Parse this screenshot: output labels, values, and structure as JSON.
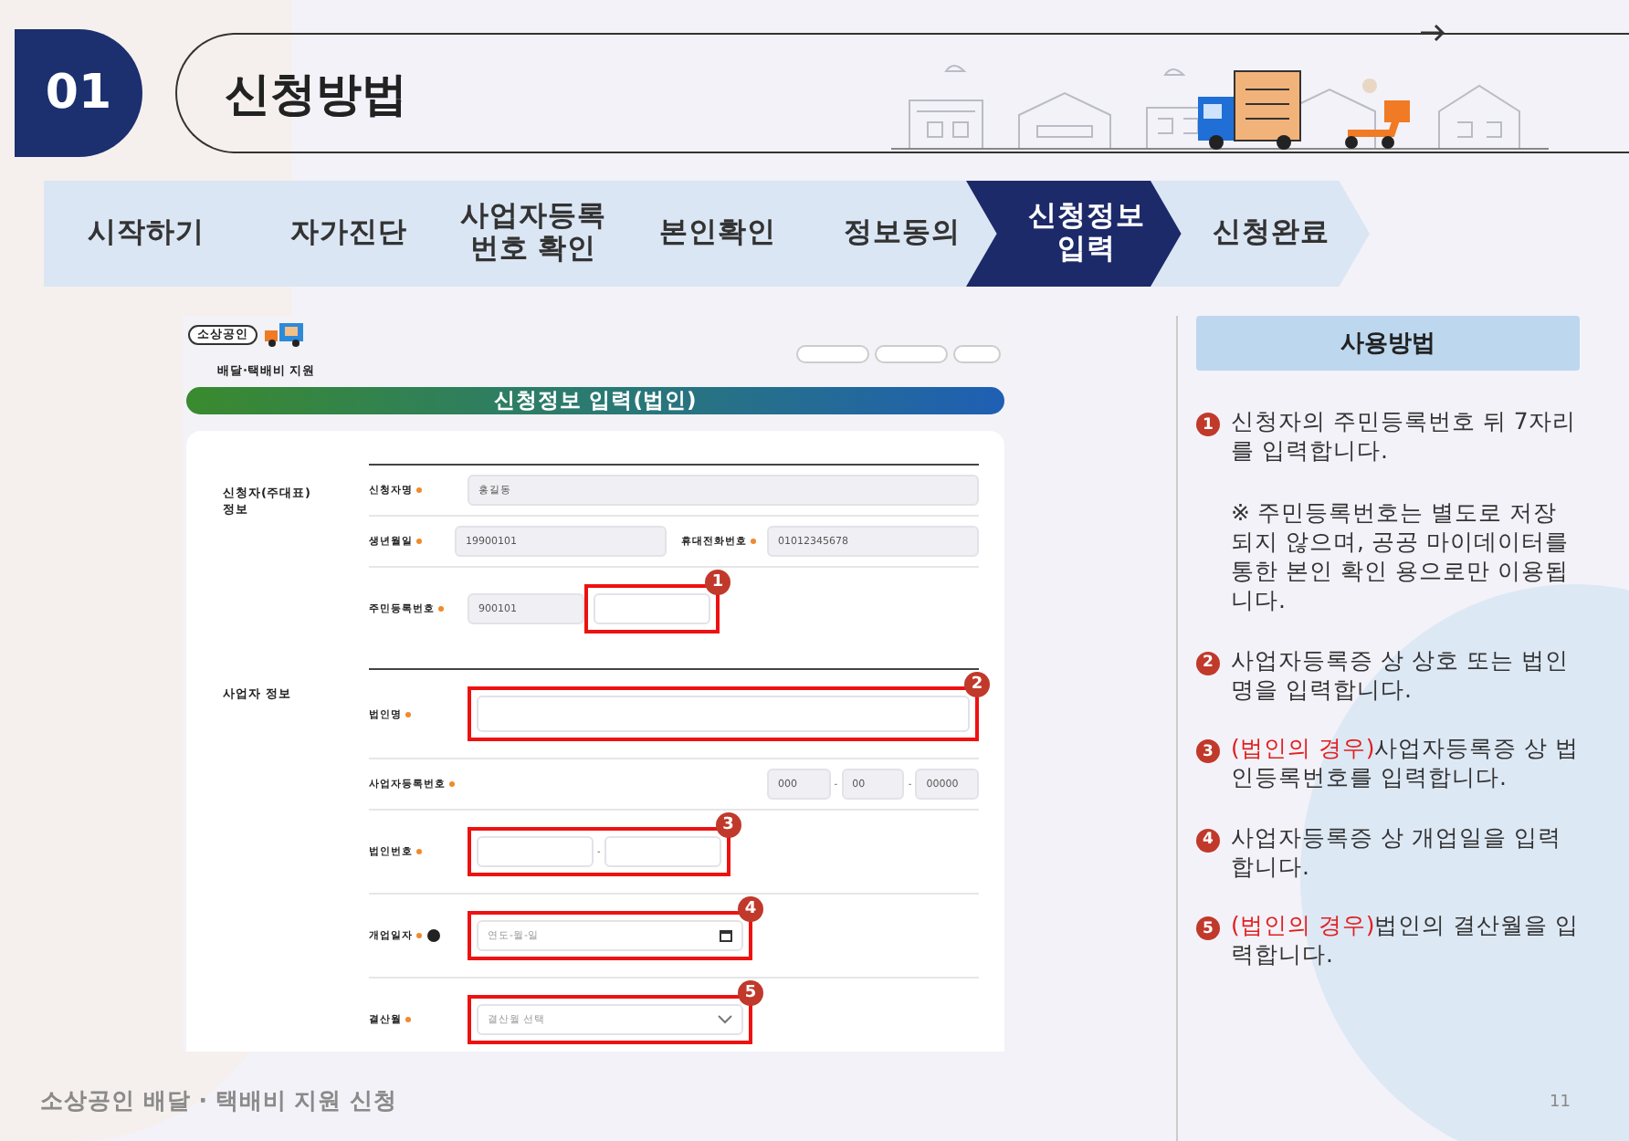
{
  "header": {
    "number": "01",
    "title": "신청방법"
  },
  "steps": [
    {
      "label": "시작하기",
      "selected": false
    },
    {
      "label": "자가진단",
      "selected": false
    },
    {
      "label": "사업자등록\n번호 확인",
      "selected": false
    },
    {
      "label": "본인확인",
      "selected": false
    },
    {
      "label": "정보동의",
      "selected": false
    },
    {
      "label": "신청정보\n입력",
      "selected": true
    },
    {
      "label": "신청완료",
      "selected": false
    }
  ],
  "screenshot": {
    "logo_badge": "소상공인",
    "logo_text": "배달·택배비 지원",
    "banner": "신청정보 입력(법인)",
    "sections": [
      {
        "title": "신청자(주대표)\n정보",
        "rows": [
          {
            "cells": [
              {
                "label": "신청자명",
                "required": true,
                "fields": [
                  {
                    "kind": "text",
                    "value": "홍길동",
                    "marked": false
                  }
                ]
              }
            ]
          },
          {
            "cells": [
              {
                "label": "생년월일",
                "required": true,
                "fields": [
                  {
                    "kind": "text",
                    "value": "19900101",
                    "marked": false
                  }
                ]
              },
              {
                "label": "휴대전화번호",
                "required": true,
                "fields": [
                  {
                    "kind": "text",
                    "value": "01012345678",
                    "marked": false
                  }
                ]
              }
            ]
          },
          {
            "marker": "1",
            "cells": [
              {
                "label": "주민등록번호",
                "required": true,
                "fields": [
                  {
                    "kind": "text",
                    "value": "900101",
                    "marked": false
                  },
                  {
                    "kind": "blank",
                    "marked": true
                  }
                ]
              }
            ]
          }
        ]
      },
      {
        "title": "사업자 정보",
        "rows": [
          {
            "marker": "2",
            "cells": [
              {
                "label": "법인명",
                "required": true,
                "fields": [
                  {
                    "kind": "blank",
                    "marked": true
                  }
                ]
              }
            ]
          },
          {
            "cells": [
              {
                "label": "사업자등록번호",
                "required": true,
                "joiner": "-",
                "fields": [
                  {
                    "kind": "text",
                    "value": "000",
                    "marked": false
                  },
                  {
                    "kind": "text",
                    "value": "00",
                    "marked": false
                  },
                  {
                    "kind": "text",
                    "value": "00000",
                    "marked": false
                  }
                ]
              }
            ]
          },
          {
            "marker": "3",
            "cells": [
              {
                "label": "법인번호",
                "required": true,
                "joiner": "-",
                "fields": [
                  {
                    "kind": "blank",
                    "marked": true
                  },
                  {
                    "kind": "blank",
                    "marked": true
                  }
                ]
              }
            ]
          },
          {
            "marker": "4",
            "cells": [
              {
                "label": "개업일자",
                "required": true,
                "help": true,
                "fields": [
                  {
                    "kind": "date",
                    "placeholder": "연도-월-일",
                    "marked": true
                  }
                ]
              }
            ]
          },
          {
            "marker": "5",
            "cells": [
              {
                "label": "결산월",
                "required": true,
                "fields": [
                  {
                    "kind": "select",
                    "placeholder": "결산월 선택",
                    "marked": true
                  }
                ]
              }
            ]
          }
        ]
      }
    ]
  },
  "guide": {
    "title": "사용방법",
    "items": [
      {
        "number": "1",
        "text": "신청자의 주민등록번호 뒤 7자리를 입력합니다.",
        "note": "※ 주민등록번호는 별도로 저장되지 않으며, 공공 마이데이터를 통한 본인 확인 용으로만 이용됩니다."
      },
      {
        "number": "2",
        "text": "사업자등록증 상 상호 또는 법인명을 입력합니다."
      },
      {
        "number": "3",
        "prefix": "(법인의 경우)",
        "text": "사업자등록증 상 법인등록번호를 입력합니다."
      },
      {
        "number": "4",
        "text": "사업자등록증 상 개업일을 입력합니다."
      },
      {
        "number": "5",
        "prefix": "(법인의 경우)",
        "text": "법인의 결산월을 입력합니다."
      }
    ]
  },
  "footer": {
    "text": "소상공인 배달 · 택배비 지원 신청",
    "page": "11"
  }
}
